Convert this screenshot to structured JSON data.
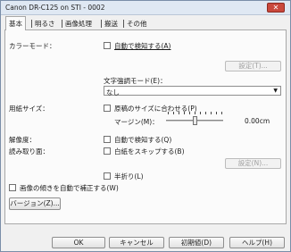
{
  "window": {
    "title": "Canon DR-C125 on STI - 0002",
    "close_glyph": "✕"
  },
  "tabs": [
    {
      "label": "基本",
      "active": true
    },
    {
      "label": "明るさ",
      "active": false
    },
    {
      "label": "画像処理",
      "active": false
    },
    {
      "label": "搬送",
      "active": false
    },
    {
      "label": "その他",
      "active": false
    }
  ],
  "color_mode": {
    "label": "カラーモード：",
    "auto_detect_label": "自動で検知する(A)",
    "settings_button": "設定(T)...",
    "text_enhance_label": "文字強調モード(E)：",
    "text_enhance_value": "なし"
  },
  "paper_size": {
    "label": "用紙サイズ：",
    "match_original_label": "原稿のサイズに合わせる(P)",
    "margin_label": "マージン(M)：",
    "margin_value": "0.00cm"
  },
  "resolution": {
    "label": "解像度：",
    "auto_detect_label": "自動で検知する(Q)"
  },
  "scan_side": {
    "label": "読み取り面：",
    "skip_blank_label": "白紙をスキップする(B)",
    "settings_button": "設定(N)...",
    "folding_label": "半折り(L)"
  },
  "deskew_label": "画像の傾きを自動で補正する(W)",
  "version_button": "バージョン(Z)...",
  "footer": {
    "ok": "OK",
    "cancel": "キャンセル",
    "defaults": "初期値(D)",
    "help": "ヘルプ(H)"
  }
}
